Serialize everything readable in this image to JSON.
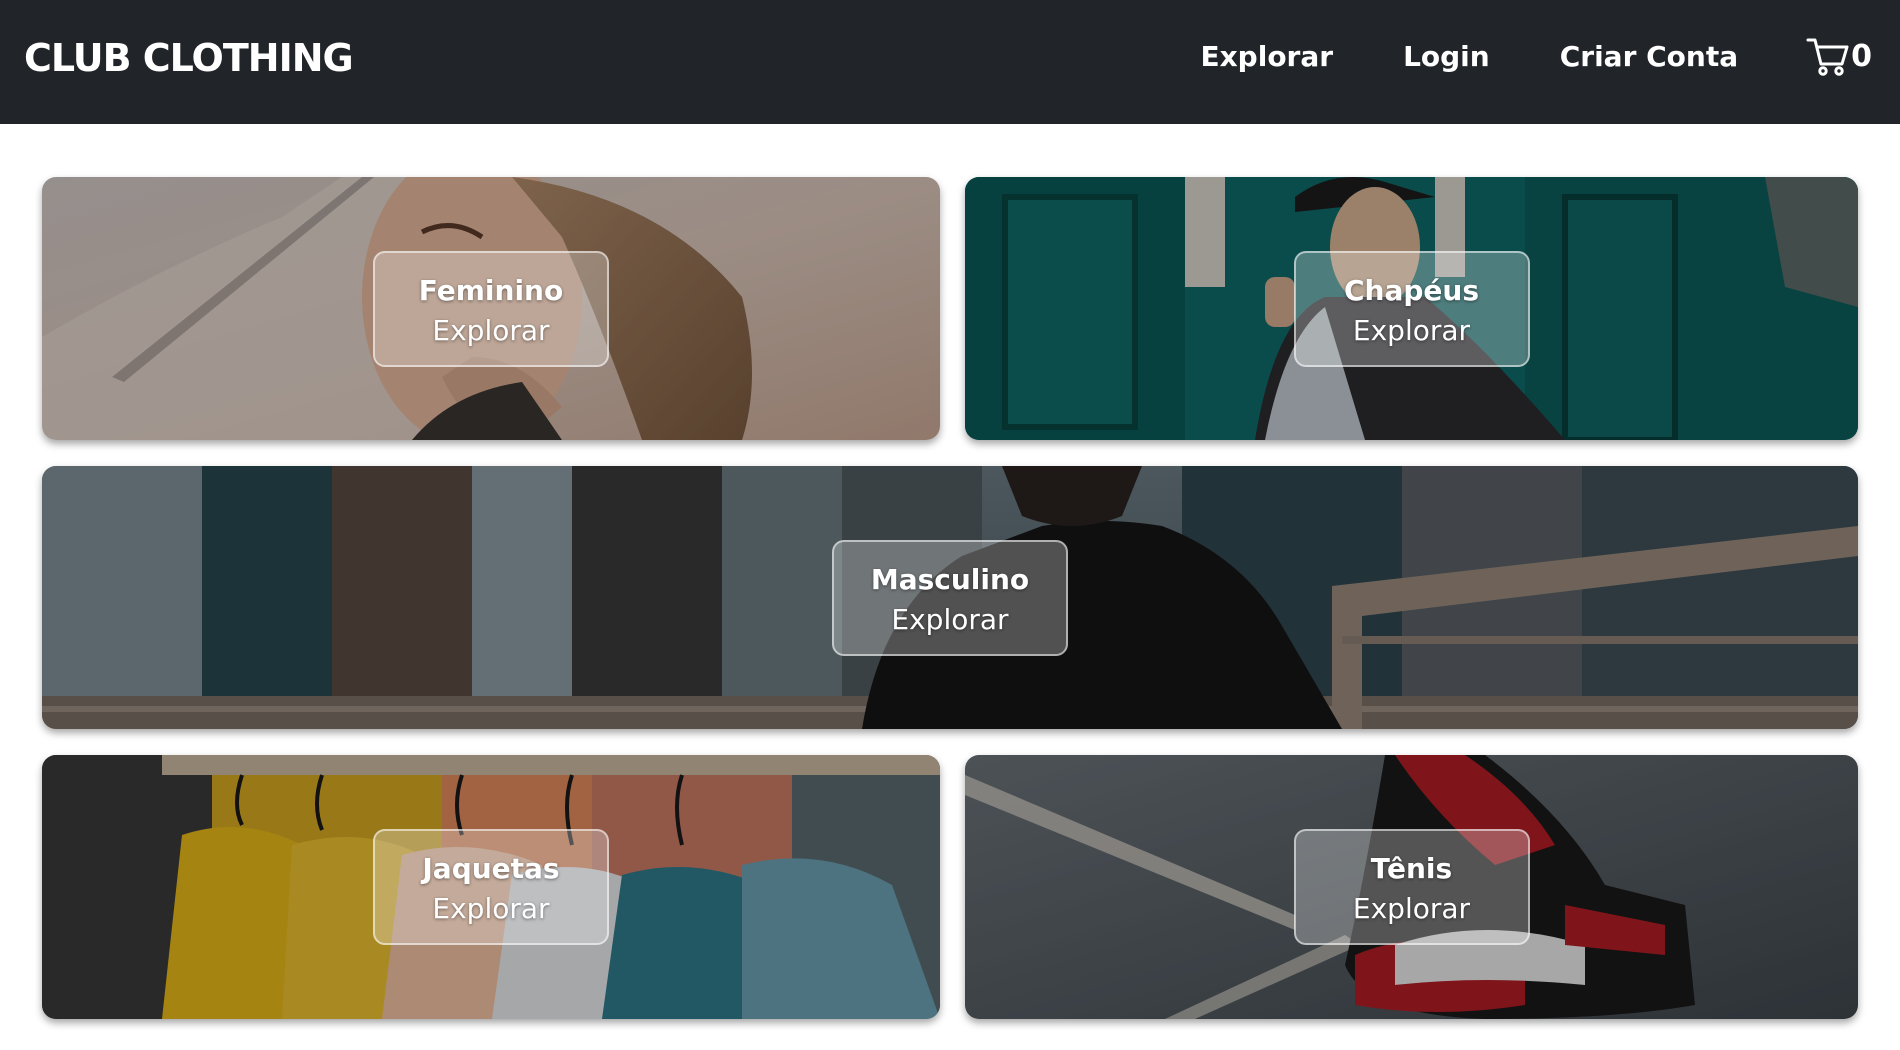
{
  "header": {
    "logo": "CLUB CLOTHING",
    "nav": [
      {
        "label": "Explorar"
      },
      {
        "label": "Login"
      },
      {
        "label": "Criar Conta"
      }
    ],
    "cart_count": "0",
    "cart_icon": "cart-icon"
  },
  "categories": [
    {
      "title": "Feminino",
      "subtitle": "Explorar"
    },
    {
      "title": "Chapéus",
      "subtitle": "Explorar"
    },
    {
      "title": "Masculino",
      "subtitle": "Explorar"
    },
    {
      "title": "Jaquetas",
      "subtitle": "Explorar"
    },
    {
      "title": "Tênis",
      "subtitle": "Explorar"
    }
  ],
  "colors": {
    "navbar": "#212529",
    "text": "#ffffff"
  }
}
